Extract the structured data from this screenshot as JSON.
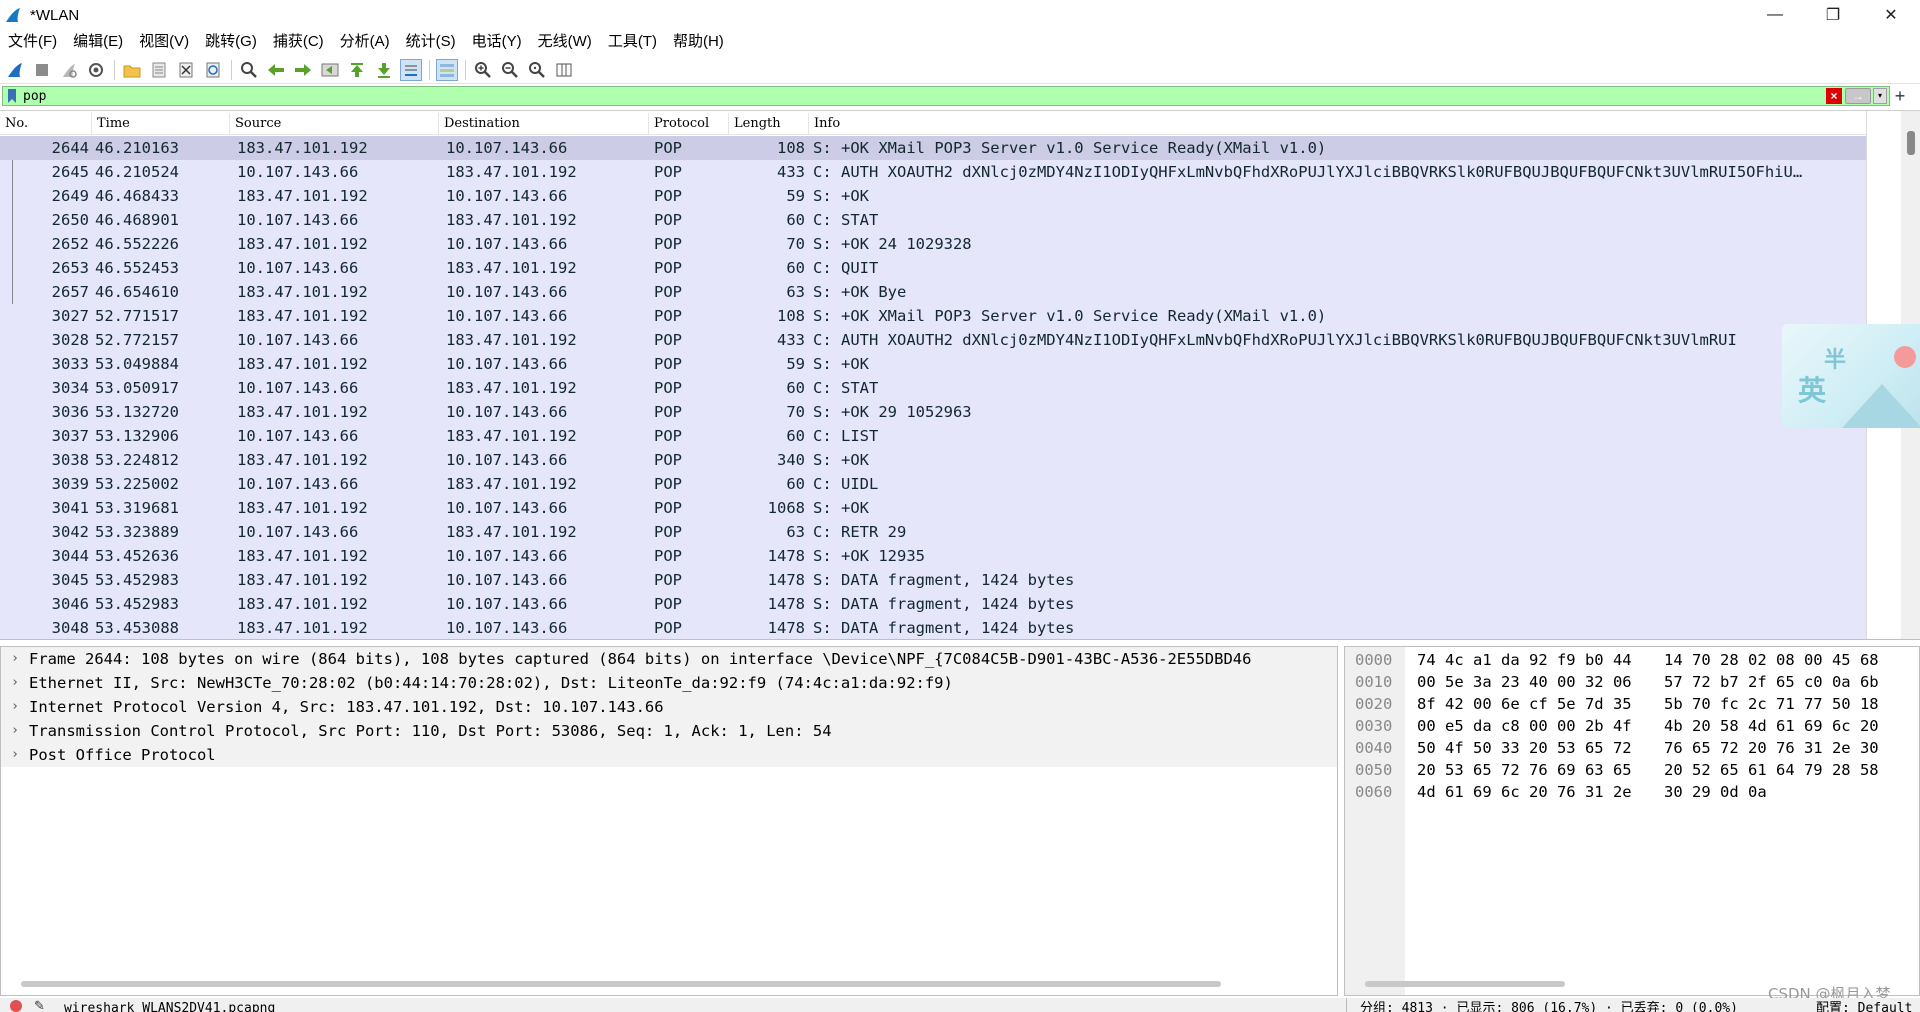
{
  "window": {
    "title": "*WLAN",
    "minimize": "—",
    "restore": "❐",
    "close": "✕"
  },
  "menu": [
    "文件(F)",
    "编辑(E)",
    "视图(V)",
    "跳转(G)",
    "捕获(C)",
    "分析(A)",
    "统计(S)",
    "电话(Y)",
    "无线(W)",
    "工具(T)",
    "帮助(H)"
  ],
  "toolbar_icons": [
    "start-capture-icon",
    "stop-capture-icon",
    "restart-capture-icon",
    "capture-options-icon",
    "open-file-icon",
    "save-file-icon",
    "close-file-icon",
    "reload-file-icon",
    "find-packet-icon",
    "go-back-icon",
    "go-forward-icon",
    "go-to-packet-icon",
    "go-first-icon",
    "go-last-icon",
    "autoscroll-icon",
    "colorize-icon",
    "zoom-in-icon",
    "zoom-out-icon",
    "zoom-normal-icon",
    "resize-columns-icon"
  ],
  "filter": {
    "value": "pop",
    "clear_icon": "×",
    "apply_icon": "→",
    "dropdown_icon": "▾",
    "add_icon": "+"
  },
  "packet_list": {
    "columns": [
      "No.",
      "Time",
      "Source",
      "Destination",
      "Protocol",
      "Length",
      "Info"
    ],
    "rows": [
      {
        "no": "2644",
        "time": "46.210163",
        "src": "183.47.101.192",
        "dst": "10.107.143.66",
        "proto": "POP",
        "len": "108",
        "info": "S: +OK XMail POP3 Server v1.0 Service Ready(XMail v1.0)",
        "selected": true
      },
      {
        "no": "2645",
        "time": "46.210524",
        "src": "10.107.143.66",
        "dst": "183.47.101.192",
        "proto": "POP",
        "len": "433",
        "info": "C: AUTH XOAUTH2 dXNlcj0zMDY4NzI1ODIyQHFxLmNvbQFhdXRoPUJlYXJlciBBQVRKSlk0RUFBQUJBQUFBQUFCNkt3UVlmRUI5OFhiU…"
      },
      {
        "no": "2649",
        "time": "46.468433",
        "src": "183.47.101.192",
        "dst": "10.107.143.66",
        "proto": "POP",
        "len": "59",
        "info": "S: +OK"
      },
      {
        "no": "2650",
        "time": "46.468901",
        "src": "10.107.143.66",
        "dst": "183.47.101.192",
        "proto": "POP",
        "len": "60",
        "info": "C: STAT"
      },
      {
        "no": "2652",
        "time": "46.552226",
        "src": "183.47.101.192",
        "dst": "10.107.143.66",
        "proto": "POP",
        "len": "70",
        "info": "S: +OK 24 1029328"
      },
      {
        "no": "2653",
        "time": "46.552453",
        "src": "10.107.143.66",
        "dst": "183.47.101.192",
        "proto": "POP",
        "len": "60",
        "info": "C: QUIT"
      },
      {
        "no": "2657",
        "time": "46.654610",
        "src": "183.47.101.192",
        "dst": "10.107.143.66",
        "proto": "POP",
        "len": "63",
        "info": "S: +OK Bye"
      },
      {
        "no": "3027",
        "time": "52.771517",
        "src": "183.47.101.192",
        "dst": "10.107.143.66",
        "proto": "POP",
        "len": "108",
        "info": "S: +OK XMail POP3 Server v1.0 Service Ready(XMail v1.0)"
      },
      {
        "no": "3028",
        "time": "52.772157",
        "src": "10.107.143.66",
        "dst": "183.47.101.192",
        "proto": "POP",
        "len": "433",
        "info": "C: AUTH XOAUTH2 dXNlcj0zMDY4NzI1ODIyQHFxLmNvbQFhdXRoPUJlYXJlciBBQVRKSlk0RUFBQUJBQUFBQUFCNkt3UVlmRUI"
      },
      {
        "no": "3033",
        "time": "53.049884",
        "src": "183.47.101.192",
        "dst": "10.107.143.66",
        "proto": "POP",
        "len": "59",
        "info": "S: +OK"
      },
      {
        "no": "3034",
        "time": "53.050917",
        "src": "10.107.143.66",
        "dst": "183.47.101.192",
        "proto": "POP",
        "len": "60",
        "info": "C: STAT"
      },
      {
        "no": "3036",
        "time": "53.132720",
        "src": "183.47.101.192",
        "dst": "10.107.143.66",
        "proto": "POP",
        "len": "70",
        "info": "S: +OK 29 1052963"
      },
      {
        "no": "3037",
        "time": "53.132906",
        "src": "10.107.143.66",
        "dst": "183.47.101.192",
        "proto": "POP",
        "len": "60",
        "info": "C: LIST"
      },
      {
        "no": "3038",
        "time": "53.224812",
        "src": "183.47.101.192",
        "dst": "10.107.143.66",
        "proto": "POP",
        "len": "340",
        "info": "S: +OK"
      },
      {
        "no": "3039",
        "time": "53.225002",
        "src": "10.107.143.66",
        "dst": "183.47.101.192",
        "proto": "POP",
        "len": "60",
        "info": "C: UIDL"
      },
      {
        "no": "3041",
        "time": "53.319681",
        "src": "183.47.101.192",
        "dst": "10.107.143.66",
        "proto": "POP",
        "len": "1068",
        "info": "S: +OK"
      },
      {
        "no": "3042",
        "time": "53.323889",
        "src": "10.107.143.66",
        "dst": "183.47.101.192",
        "proto": "POP",
        "len": "63",
        "info": "C: RETR 29"
      },
      {
        "no": "3044",
        "time": "53.452636",
        "src": "183.47.101.192",
        "dst": "10.107.143.66",
        "proto": "POP",
        "len": "1478",
        "info": "S: +OK 12935"
      },
      {
        "no": "3045",
        "time": "53.452983",
        "src": "183.47.101.192",
        "dst": "10.107.143.66",
        "proto": "POP",
        "len": "1478",
        "info": "S: DATA fragment, 1424 bytes"
      },
      {
        "no": "3046",
        "time": "53.452983",
        "src": "183.47.101.192",
        "dst": "10.107.143.66",
        "proto": "POP",
        "len": "1478",
        "info": "S: DATA fragment, 1424 bytes"
      },
      {
        "no": "3048",
        "time": "53.453088",
        "src": "183.47.101.192",
        "dst": "10.107.143.66",
        "proto": "POP",
        "len": "1478",
        "info": "S: DATA fragment, 1424 bytes"
      }
    ]
  },
  "floating_widget": {
    "line1": "半",
    "line2": "英"
  },
  "details": [
    "Frame 2644: 108 bytes on wire (864 bits), 108 bytes captured (864 bits) on interface \\Device\\NPF_{7C084C5B-D901-43BC-A536-2E55DBD46",
    "Ethernet II, Src: NewH3CTe_70:28:02 (b0:44:14:70:28:02), Dst: LiteonTe_da:92:f9 (74:4c:a1:da:92:f9)",
    "Internet Protocol Version 4, Src: 183.47.101.192, Dst: 10.107.143.66",
    "Transmission Control Protocol, Src Port: 110, Dst Port: 53086, Seq: 1, Ack: 1, Len: 54",
    "Post Office Protocol"
  ],
  "bytes": [
    {
      "off": "0000",
      "h1": "74 4c a1 da 92 f9 b0 44",
      "h2": "14 70 28 02 08 00 45 68"
    },
    {
      "off": "0010",
      "h1": "00 5e 3a 23 40 00 32 06",
      "h2": "57 72 b7 2f 65 c0 0a 6b"
    },
    {
      "off": "0020",
      "h1": "8f 42 00 6e cf 5e 7d 35",
      "h2": "5b 70 fc 2c 71 77 50 18"
    },
    {
      "off": "0030",
      "h1": "00 e5 da c8 00 00 2b 4f",
      "h2": "4b 20 58 4d 61 69 6c 20"
    },
    {
      "off": "0040",
      "h1": "50 4f 50 33 20 53 65 72",
      "h2": "76 65 72 20 76 31 2e 30"
    },
    {
      "off": "0050",
      "h1": "20 53 65 72 76 69 63 65",
      "h2": "20 52 65 61 64 79 28 58"
    },
    {
      "off": "0060",
      "h1": "4d 61 69 6c 20 76 31 2e",
      "h2": "30 29 0d 0a"
    }
  ],
  "status": {
    "file": "wireshark_WLANS2DV41.pcapng",
    "stats": "分组: 4813 · 已显示: 806 (16.7%) · 已丢弃: 0 (0.0%)",
    "profile": "配置: Default"
  },
  "watermark": "CSDN @枫月入梦",
  "colors": {
    "filter_valid_bg": "#afffaf",
    "row_bg": "#e6e6fa",
    "row_selected_bg": "#cccce6",
    "row_text": "#12272e"
  }
}
